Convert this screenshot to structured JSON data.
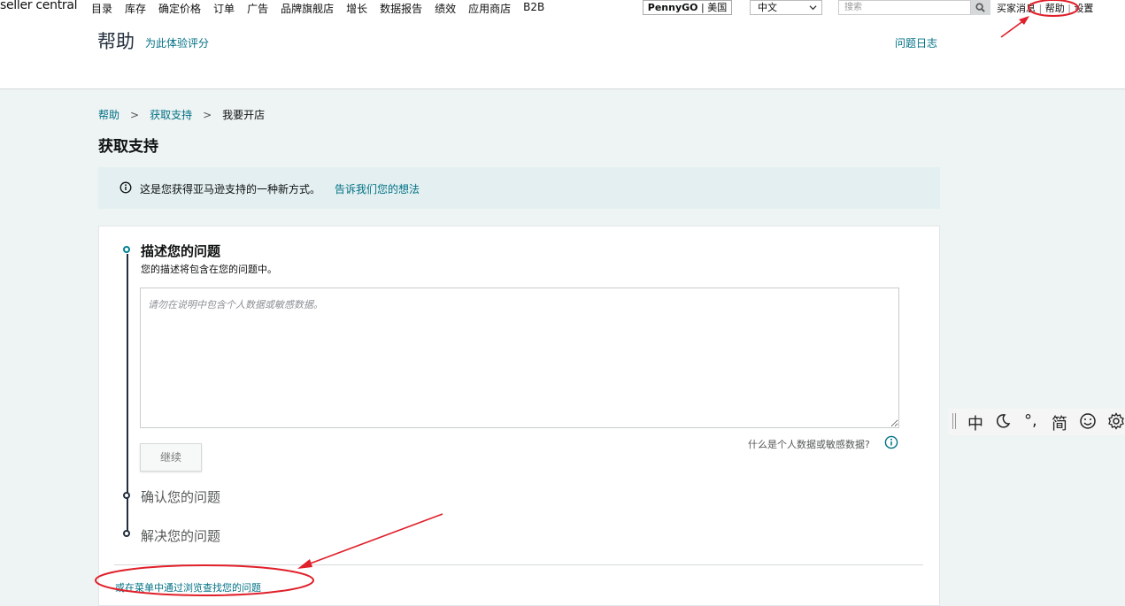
{
  "topnav": {
    "logo": "seller central",
    "items": [
      "目录",
      "库存",
      "确定价格",
      "订单",
      "广告",
      "品牌旗舰店",
      "增长",
      "数据报告",
      "绩效",
      "应用商店",
      "B2B"
    ],
    "store_name": "PennyGO",
    "store_sep": " | ",
    "store_region": "美国",
    "language": "中文",
    "search_placeholder": "搜索",
    "buyer_messages": "买家消息",
    "help": "帮助",
    "settings": "设置",
    "sep": "|"
  },
  "header": {
    "title": "帮助",
    "rate_link": "为此体验评分",
    "case_log": "问题日志"
  },
  "breadcrumb": {
    "items": [
      "帮助",
      "获取支持",
      "我要开店"
    ],
    "separator": ">"
  },
  "page_title": "获取支持",
  "banner": {
    "text": "这是您获得亚马逊支持的一种新方式。",
    "link": "告诉我们您的想法"
  },
  "steps": {
    "step1": {
      "title": "描述您的问题",
      "subtitle": "您的描述将包含在您的问题中。",
      "placeholder": "请勿在说明中包含个人数据或敏感数据。",
      "continue_label": "继续",
      "pii_question": "什么是个人数据或敏感数据?"
    },
    "step2_title": "确认您的问题",
    "step3_title": "解决您的问题"
  },
  "browse_link": "或在菜单中通过浏览查找您的问题",
  "ime_toolbar": {
    "mode": "中",
    "punct": "°,",
    "script": "简"
  },
  "colors": {
    "link": "#007185",
    "banner_bg": "#e3eff0",
    "annotation_red": "#e0202a",
    "step_active": "#008296",
    "background": "#eef3f3"
  }
}
